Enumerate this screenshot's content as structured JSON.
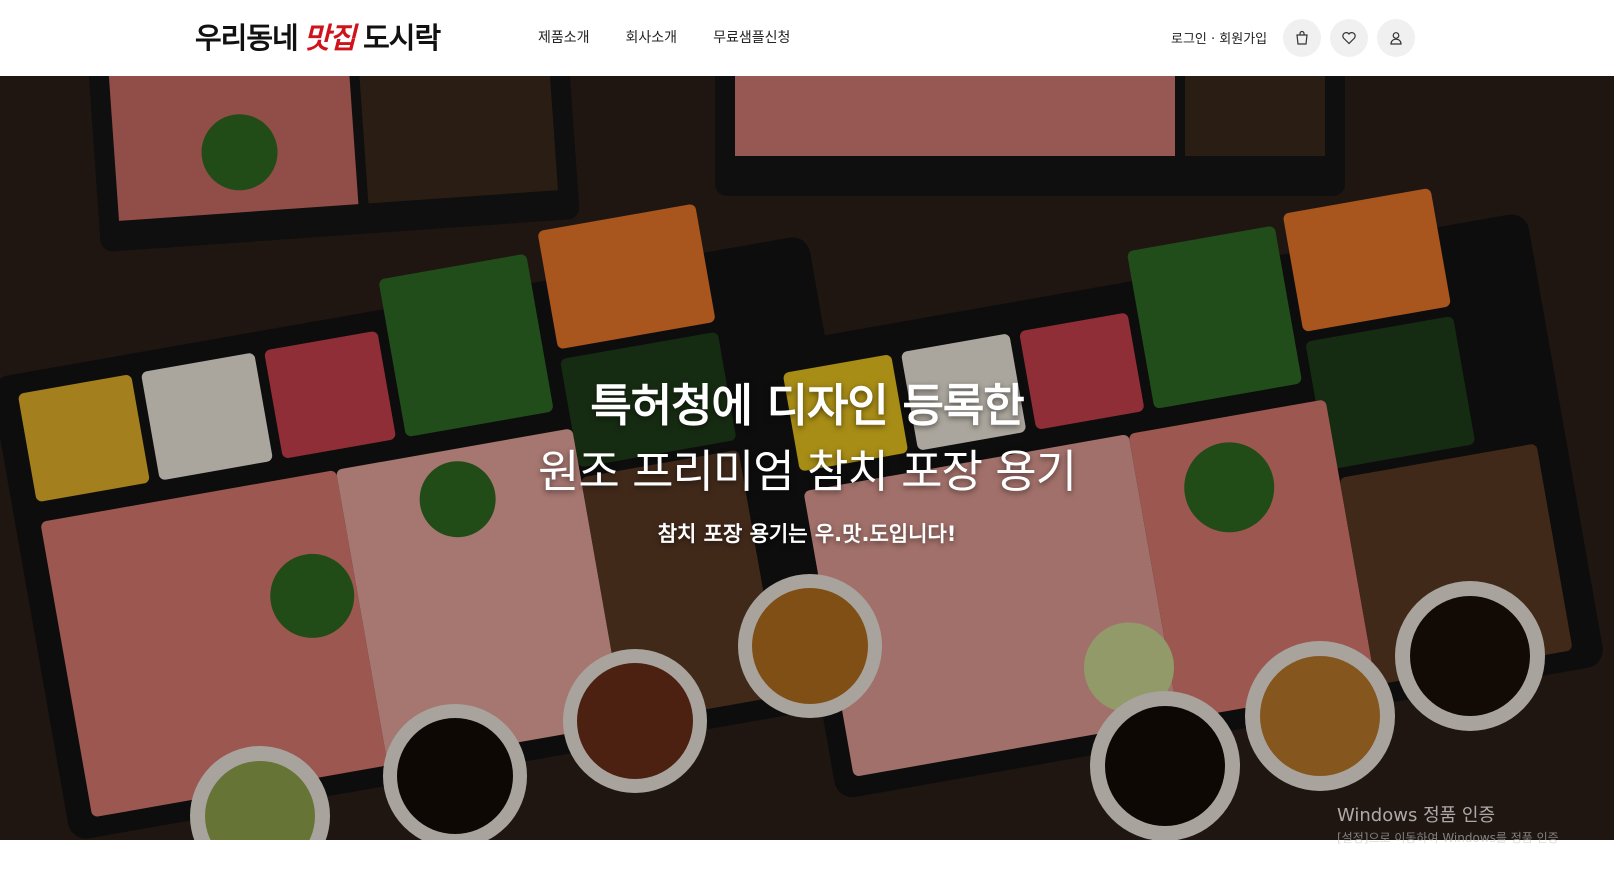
{
  "header": {
    "logo": {
      "part1": "우리동네",
      "accent": "맛집",
      "part2": "도시락"
    },
    "nav": [
      "제품소개",
      "회사소개",
      "무료샘플신청"
    ],
    "login": "로그인 · 회원가입",
    "icons": [
      "bag-icon",
      "heart-icon",
      "user-icon"
    ]
  },
  "hero": {
    "title_line1": "특허청에 디자인 등록한",
    "title_line2": "원조 프리미엄 참치 포장 용기",
    "subtitle": "참치 포장 용기는 우.맛.도입니다!"
  },
  "watermark": {
    "line1": "Windows 정품 인증",
    "line2": "[설정]으로 이동하여 Windows를 정품 인증"
  },
  "colors": {
    "logo_accent": "#d0121b",
    "icon_bg": "#f0f0f0"
  }
}
